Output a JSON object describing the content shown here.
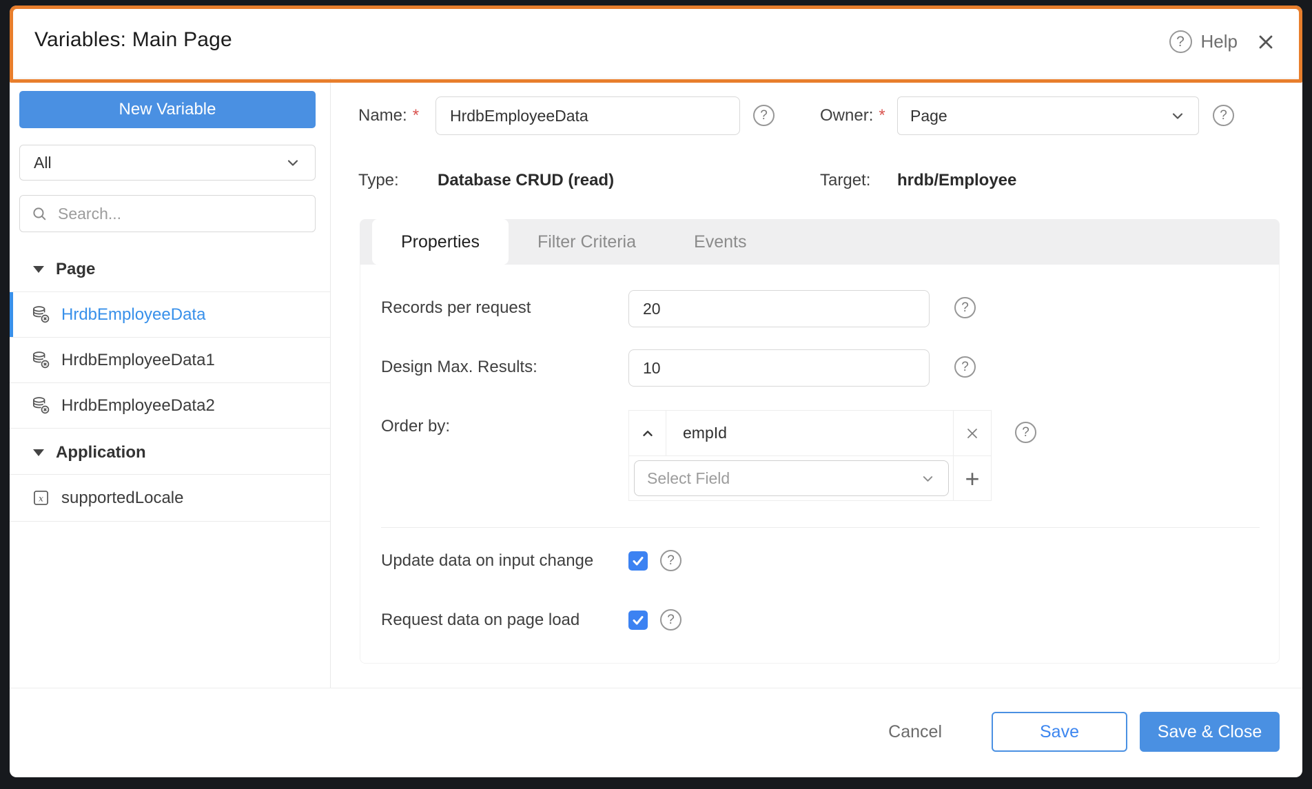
{
  "dialog": {
    "title": "Variables: Main Page"
  },
  "header": {
    "help_label": "Help"
  },
  "icons": {
    "question_mark": "?",
    "plus": "+"
  },
  "sidebar": {
    "new_variable_label": "New Variable",
    "filter_selected": "All",
    "search_placeholder": "Search...",
    "sections": [
      {
        "label": "Page",
        "items": [
          {
            "name": "HrdbEmployeeData",
            "icon": "database-icon",
            "selected": true
          },
          {
            "name": "HrdbEmployeeData1",
            "icon": "database-icon",
            "selected": false
          },
          {
            "name": "HrdbEmployeeData2",
            "icon": "database-icon",
            "selected": false
          }
        ]
      },
      {
        "label": "Application",
        "items": [
          {
            "name": "supportedLocale",
            "icon": "variable-icon",
            "selected": false
          }
        ]
      }
    ]
  },
  "form": {
    "name_label": "Name:",
    "required_marker": "*",
    "name_value": "HrdbEmployeeData",
    "owner_label": "Owner:",
    "owner_value": "Page",
    "type_label": "Type:",
    "type_value": "Database CRUD (read)",
    "target_label": "Target:",
    "target_value": "hrdb/Employee"
  },
  "tabs": [
    {
      "label": "Properties",
      "active": true
    },
    {
      "label": "Filter Criteria",
      "active": false
    },
    {
      "label": "Events",
      "active": false
    }
  ],
  "properties": {
    "records_per_request": {
      "label": "Records per request",
      "value": "20"
    },
    "design_max_results": {
      "label": "Design Max. Results:",
      "value": "10"
    },
    "order_by": {
      "label": "Order by:",
      "field": "empId",
      "select_placeholder": "Select Field"
    },
    "update_on_input": {
      "label": "Update data on input change",
      "checked": true
    },
    "request_on_load": {
      "label": "Request data on page load",
      "checked": true
    }
  },
  "footer": {
    "cancel_label": "Cancel",
    "save_label": "Save",
    "save_close_label": "Save & Close"
  },
  "colors": {
    "accent_blue": "#4a90e2",
    "highlight_orange": "#e87e2c",
    "selected_item_blue": "#3890ea",
    "checkbox_blue": "#3c82f2",
    "required_red": "#d9534f"
  }
}
